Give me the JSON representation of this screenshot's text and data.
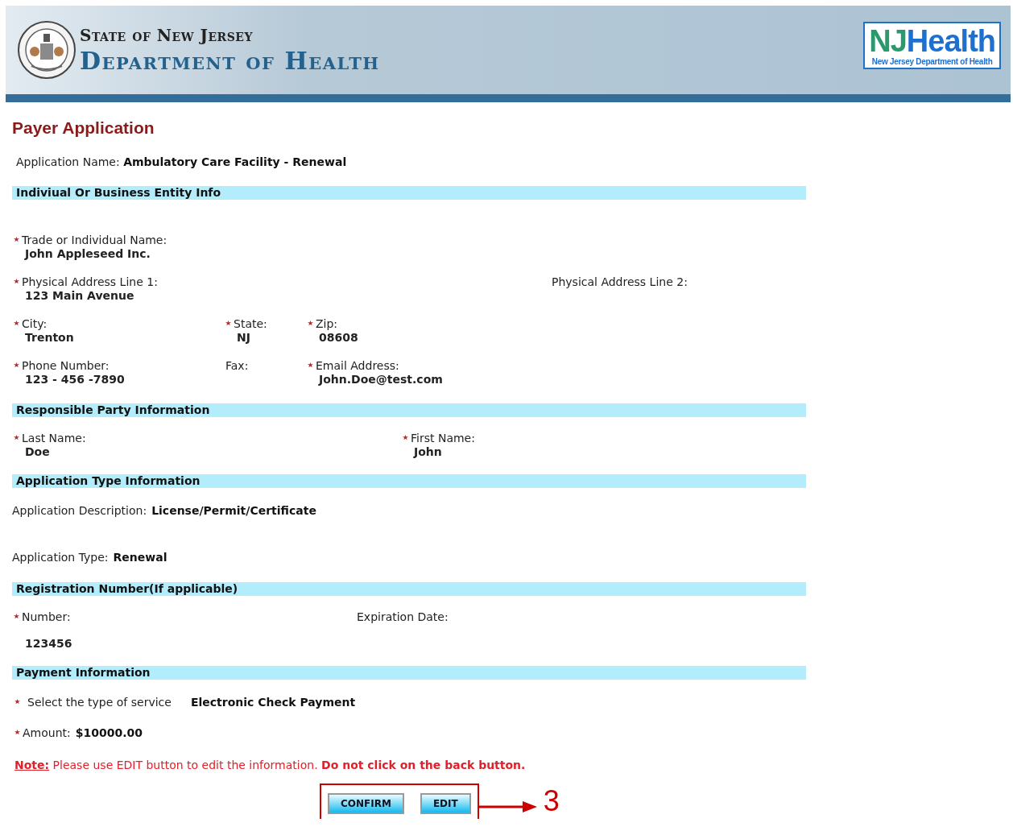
{
  "header": {
    "state_line": "State of New Jersey",
    "dept_line": "Department of Health",
    "logo": {
      "mark": "NJ",
      "word": "Health",
      "tagline": "New Jersey Department of Health"
    }
  },
  "page_title": "Payer Application",
  "application_name": {
    "label": "Application Name:",
    "value": "Ambulatory Care Facility - Renewal"
  },
  "sections": [
    {
      "title": "Indiviual Or Business Entity Info",
      "kind": "grid",
      "rows": [
        [
          {
            "label": "Trade or Individual Name:",
            "value": "John Appleseed Inc.",
            "required": true
          }
        ],
        [
          {
            "label": "Physical Address Line 1:",
            "value": "123 Main Avenue",
            "required": true
          },
          {
            "label": "Physical Address Line 2:",
            "required": false
          }
        ],
        [
          {
            "label": "City:",
            "value": "Trenton",
            "required": true
          },
          {
            "label": "State:",
            "value": "NJ",
            "required": true
          },
          {
            "label": "Zip:",
            "value": "08608",
            "required": true
          }
        ],
        [
          {
            "label": "Phone Number:",
            "value": "123 - 456 -7890",
            "required": true
          },
          {
            "label": "Fax:",
            "required": false
          },
          {
            "label": "Email Address:",
            "value": "John.Doe@test.com",
            "required": true
          }
        ]
      ]
    },
    {
      "title": "Responsible Party Information",
      "kind": "grid",
      "rows": [
        [
          {
            "label": "Last Name:",
            "value": "Doe",
            "required": true
          },
          {
            "label": "First Name:",
            "value": "John",
            "required": true
          }
        ]
      ]
    },
    {
      "title": "Application Type Information",
      "kind": "inline",
      "rows": [
        [
          {
            "label": "Application Description:",
            "value": "License/Permit/Certificate",
            "required": false
          }
        ],
        [
          {
            "label": "Application Type:",
            "value": "Renewal",
            "required": false
          }
        ]
      ]
    },
    {
      "title": "Registration Number(If applicable)",
      "kind": "grid",
      "rows": [
        [
          {
            "label": "Number:",
            "value": "123456",
            "required": true
          },
          {
            "label": "Expiration Date:",
            "required": false
          }
        ]
      ]
    },
    {
      "title": "Payment Information",
      "kind": "inline",
      "rows": [
        [
          {
            "label": "Select the type of service",
            "value": "Electronic Check Payment",
            "required": true
          }
        ],
        [
          {
            "label": "Amount:",
            "value": "$10000.00",
            "required": true
          }
        ]
      ]
    }
  ],
  "note": {
    "label": "Note:",
    "text": "Please use EDIT button to edit the information.",
    "emphasis": "Do not click on the back button."
  },
  "buttons": [
    "CONFIRM",
    "EDIT"
  ],
  "callout": "3"
}
